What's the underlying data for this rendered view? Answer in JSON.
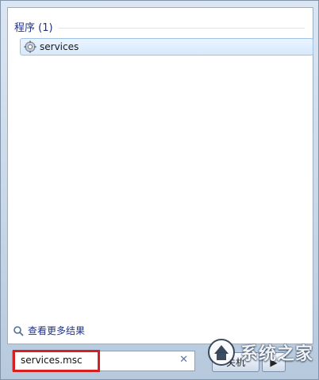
{
  "results": {
    "section_header": "程序 (1)",
    "items": [
      {
        "label": "services",
        "icon": "gear-icon"
      }
    ]
  },
  "see_more": {
    "label": "查看更多结果",
    "icon": "search-icon"
  },
  "search": {
    "value": "services.msc",
    "clear_icon": "✕"
  },
  "buttons": {
    "shutdown_label": "关机",
    "arrow_label": "▶"
  },
  "watermark": {
    "text": "系统之家"
  },
  "colors": {
    "highlight": "#d81f1f",
    "link": "#1e3287"
  }
}
